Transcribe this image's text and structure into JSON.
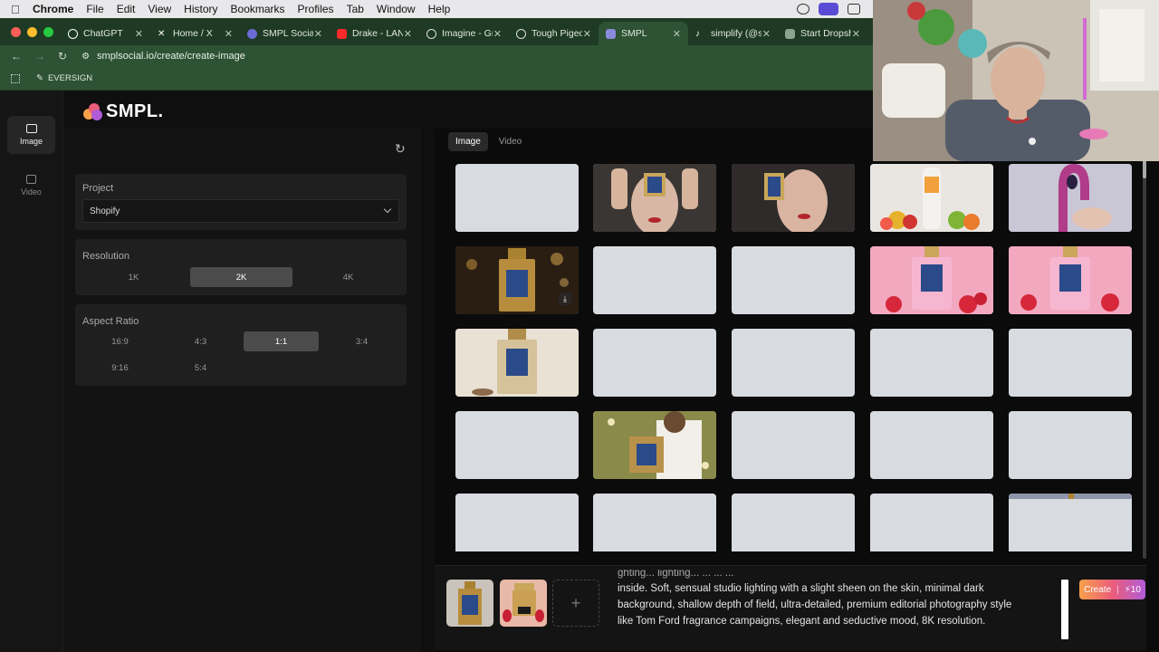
{
  "menubar": {
    "apple": "",
    "items": [
      "Chrome",
      "File",
      "Edit",
      "View",
      "History",
      "Bookmarks",
      "Profiles",
      "Tab",
      "Window",
      "Help"
    ]
  },
  "tabs": [
    {
      "label": "ChatGPT",
      "color": "#ffffff"
    },
    {
      "label": "Home / X",
      "color": "#000000"
    },
    {
      "label": "SMPL Social",
      "color": "#6b6bd6"
    },
    {
      "label": "Drake - LAND",
      "color": "#ff2a2a"
    },
    {
      "label": "Imagine - Gro",
      "color": "#dddddd"
    },
    {
      "label": "Tough Pigeon",
      "color": "#dddddd"
    },
    {
      "label": "SMPL",
      "color": "#6b6bd6",
      "active": true
    },
    {
      "label": "simplify (@si",
      "color": "#111111"
    },
    {
      "label": "Start Dropsh",
      "color": "#8aa58f"
    }
  ],
  "address": {
    "url": "smplsocial.io/create/create-image"
  },
  "bookmarks": {
    "item": "EVERSIGN"
  },
  "rail": {
    "image_label": "Image",
    "video_label": "Video"
  },
  "logo": {
    "text": "SMPL."
  },
  "settings": {
    "project_title": "Project",
    "project_value": "Shopify",
    "resolution_title": "Resolution",
    "resolutions": [
      "1K",
      "2K",
      "4K"
    ],
    "resolution_selected": "2K",
    "aspect_title": "Aspect Ratio",
    "aspects": [
      "16:9",
      "4:3",
      "1:1",
      "3:4",
      "9:16",
      "5:4"
    ],
    "aspect_selected": "1:1"
  },
  "gallery": {
    "tab_image": "Image",
    "tab_video": "Video",
    "active_tab": "Image"
  },
  "composer": {
    "prompt_fade": "ghting... lighting... ... ... ...",
    "prompt_line1": "inside. Soft, sensual studio lighting with a slight sheen on the skin, minimal dark",
    "prompt_line2": "background, shallow depth of field, ultra-detailed, premium editorial photography style",
    "prompt_line3": "like Tom Ford fragrance campaigns, elegant and seductive mood, 8K resolution.",
    "plus": "+",
    "create_label": "Create",
    "create_cost": "⚡10"
  },
  "colors": {
    "accent_start": "#f7a04b",
    "accent_end": "#b25bd8",
    "selected": "#4b4b4b"
  }
}
